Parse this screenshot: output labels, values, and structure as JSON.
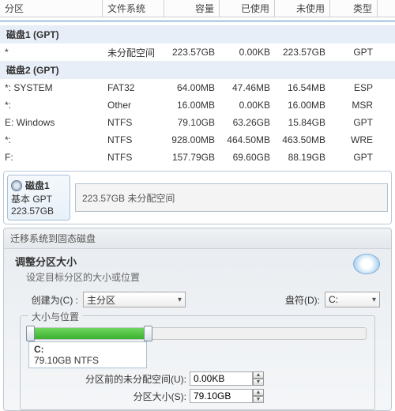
{
  "columns": {
    "c0": "分区",
    "c1": "文件系统",
    "c2": "容量",
    "c3": "已使用",
    "c4": "未使用",
    "c5": "类型"
  },
  "group1": "磁盘1 (GPT)",
  "group2": "磁盘2 (GPT)",
  "rows": [
    {
      "p": "*",
      "fs": "未分配空间",
      "cap": "223.57GB",
      "used": "0.00KB",
      "free": "223.57GB",
      "type": "GPT"
    },
    {
      "p": "*: SYSTEM",
      "fs": "FAT32",
      "cap": "64.00MB",
      "used": "47.46MB",
      "free": "16.54MB",
      "type": "ESP"
    },
    {
      "p": "*:",
      "fs": "Other",
      "cap": "16.00MB",
      "used": "0.00KB",
      "free": "16.00MB",
      "type": "MSR"
    },
    {
      "p": "E: Windows",
      "fs": "NTFS",
      "cap": "79.10GB",
      "used": "63.26GB",
      "free": "15.84GB",
      "type": "GPT"
    },
    {
      "p": "*:",
      "fs": "NTFS",
      "cap": "928.00MB",
      "used": "464.50MB",
      "free": "463.50MB",
      "type": "WRE"
    },
    {
      "p": "F:",
      "fs": "NTFS",
      "cap": "157.79GB",
      "used": "69.60GB",
      "free": "88.19GB",
      "type": "GPT"
    }
  ],
  "diskCard": {
    "name": "磁盘1",
    "line2": "基本 GPT",
    "line3": "223.57GB",
    "bar": "223.57GB 未分配空间"
  },
  "wizard": {
    "title": "迁移系统到固态磁盘",
    "heading": "调整分区大小",
    "sub": "设定目标分区的大小或位置",
    "createAsLabel": "创建为(C) :",
    "createAsValue": "主分区",
    "driveLabel": "盘符(D):",
    "driveValue": "C:",
    "fsLegend": "大小与位置",
    "partName": "C:",
    "partInfo": "79.10GB NTFS",
    "beforeLabel": "分区前的未分配空间(U):",
    "beforeValue": "0.00KB",
    "sizeLabel": "分区大小(S):",
    "sizeValue": "79.10GB"
  }
}
